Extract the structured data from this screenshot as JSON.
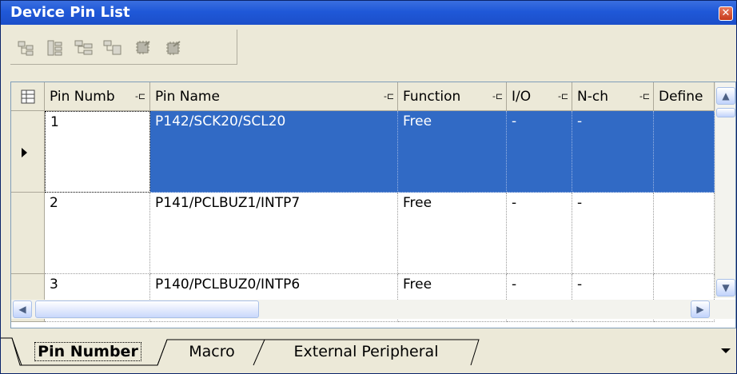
{
  "window": {
    "title": "Device Pin List",
    "close_glyph": "✕"
  },
  "toolbar": {
    "buttons": [
      "expand-all-icon",
      "collapse-all-icon",
      "expand-node-icon",
      "collapse-node-icon",
      "chip-icon",
      "chip-alt-icon"
    ]
  },
  "grid": {
    "columns": [
      "Pin Numb",
      "Pin Name",
      "Function",
      "I/O",
      "N-ch",
      "Define"
    ],
    "rows": [
      {
        "pin_number": "1",
        "pin_name": "P142/SCK20/SCL20",
        "function": "Free",
        "io": "-",
        "nch": "-",
        "define": ""
      },
      {
        "pin_number": "2",
        "pin_name": "P141/PCLBUZ1/INTP7",
        "function": "Free",
        "io": "-",
        "nch": "-",
        "define": ""
      },
      {
        "pin_number": "3",
        "pin_name": "P140/PCLBUZ0/INTP6",
        "function": "Free",
        "io": "-",
        "nch": "-",
        "define": ""
      }
    ],
    "selected_row": 1
  },
  "tabs": [
    "Pin Number",
    "Macro",
    "External Peripheral"
  ],
  "colors": {
    "title_bar": "#1f58d8",
    "selection": "#316ac5",
    "background": "#ece9d8"
  }
}
